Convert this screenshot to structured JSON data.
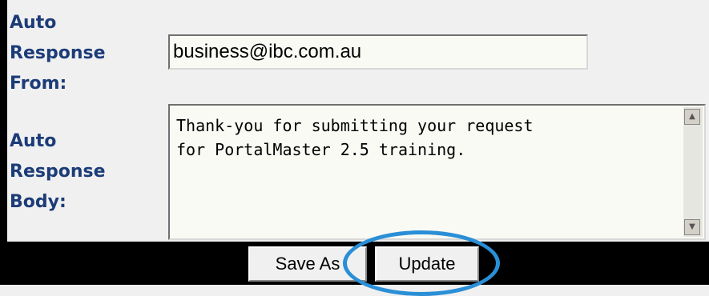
{
  "form": {
    "from_label": "Auto\nResponse\nFrom:",
    "from_value": "business@ibc.com.au",
    "body_label": "Auto\nResponse\nBody:",
    "body_value": "Thank-you for submitting your request\nfor PortalMaster 2.5 training."
  },
  "buttons": {
    "save_as": "Save As",
    "update": "Update"
  },
  "icons": {
    "scroll_up": "scroll-up-icon",
    "scroll_down": "scroll-down-icon"
  },
  "colors": {
    "label": "#1c3c78",
    "highlight_ring": "#2a8fd6",
    "bar": "#000000"
  }
}
